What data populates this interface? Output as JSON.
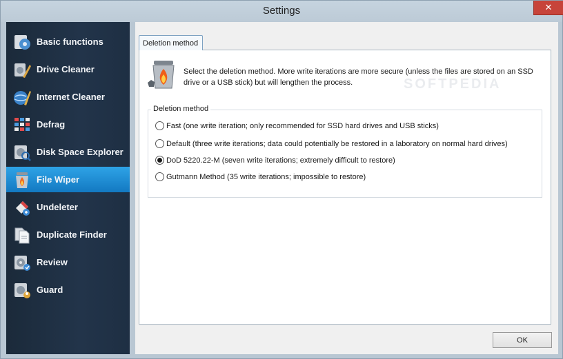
{
  "window": {
    "title": "Settings",
    "close_label": "✕"
  },
  "sidebar": {
    "items": [
      {
        "label": "Basic functions",
        "icon": "basic-functions-icon"
      },
      {
        "label": "Drive Cleaner",
        "icon": "drive-cleaner-icon"
      },
      {
        "label": "Internet Cleaner",
        "icon": "internet-cleaner-icon"
      },
      {
        "label": "Defrag",
        "icon": "defrag-icon"
      },
      {
        "label": "Disk Space Explorer",
        "icon": "disk-space-explorer-icon"
      },
      {
        "label": "File Wiper",
        "icon": "file-wiper-icon",
        "active": true
      },
      {
        "label": "Undeleter",
        "icon": "undeleter-icon"
      },
      {
        "label": "Duplicate Finder",
        "icon": "duplicate-finder-icon"
      },
      {
        "label": "Review",
        "icon": "review-icon"
      },
      {
        "label": "Guard",
        "icon": "guard-icon"
      }
    ]
  },
  "main": {
    "tab_label": "Deletion method",
    "watermark": "SOFTPEDIA",
    "description": "Select the deletion method. More write iterations are more secure (unless the files are stored on an SSD drive or a USB stick) but will lengthen the process.",
    "group_label": "Deletion method",
    "options": [
      {
        "label": "Fast (one write iteration; only recommended for SSD hard drives and USB sticks)",
        "selected": false
      },
      {
        "label": "Default (three write iterations; data could potentially be restored in a laboratory on normal hard drives)",
        "selected": false
      },
      {
        "label": "DoD 5220.22-M (seven write iterations; extremely difficult to restore)",
        "selected": true
      },
      {
        "label": "Gutmann Method (35 write iterations; impossible to restore)",
        "selected": false
      }
    ]
  },
  "footer": {
    "ok_label": "OK"
  },
  "colors": {
    "sidebar_bg": "#1e2f43",
    "active_item": "#1f8ad4",
    "accent_fire": "#e8631c"
  }
}
